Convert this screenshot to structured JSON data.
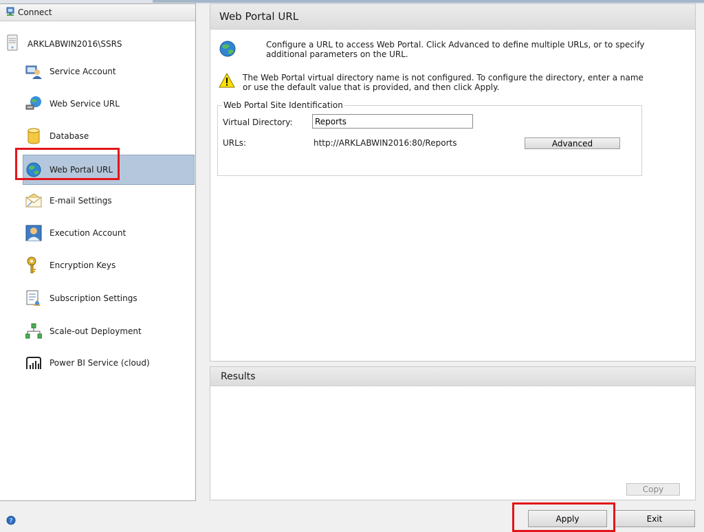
{
  "sidebar": {
    "connect_label": "Connect",
    "server_name": "ARKLABWIN2016\\SSRS",
    "items": [
      {
        "label": "Service Account",
        "icon": "service-account-icon"
      },
      {
        "label": "Web Service URL",
        "icon": "web-service-url-icon"
      },
      {
        "label": "Database",
        "icon": "database-icon"
      },
      {
        "label": "Web Portal URL",
        "icon": "globe-icon",
        "selected": true
      },
      {
        "label": "E-mail Settings",
        "icon": "email-icon"
      },
      {
        "label": "Execution Account",
        "icon": "user-icon"
      },
      {
        "label": "Encryption Keys",
        "icon": "keys-icon"
      },
      {
        "label": "Subscription Settings",
        "icon": "subscription-icon"
      },
      {
        "label": "Scale-out Deployment",
        "icon": "network-icon"
      },
      {
        "label": "Power BI Service (cloud)",
        "icon": "power-bi-icon"
      }
    ]
  },
  "main": {
    "title": "Web Portal URL",
    "intro": "Configure a URL to access Web Portal.  Click Advanced to define multiple URLs, or to specify additional parameters on the URL.",
    "warning": "The Web Portal virtual directory name is not configured. To configure the directory, enter a name or use the default value that is provided, and then click Apply.",
    "group_title": "Web Portal Site Identification",
    "vdir_label": "Virtual Directory:",
    "vdir_value": "Reports",
    "urls_label": "URLs:",
    "url_value": "http://ARKLABWIN2016:80/Reports",
    "advanced_label": "Advanced"
  },
  "results": {
    "title": "Results",
    "copy_label": "Copy"
  },
  "footer": {
    "apply_label": "Apply",
    "exit_label": "Exit"
  },
  "colors": {
    "selection": "#b5c7dc",
    "highlight_box": "#e3151a"
  }
}
